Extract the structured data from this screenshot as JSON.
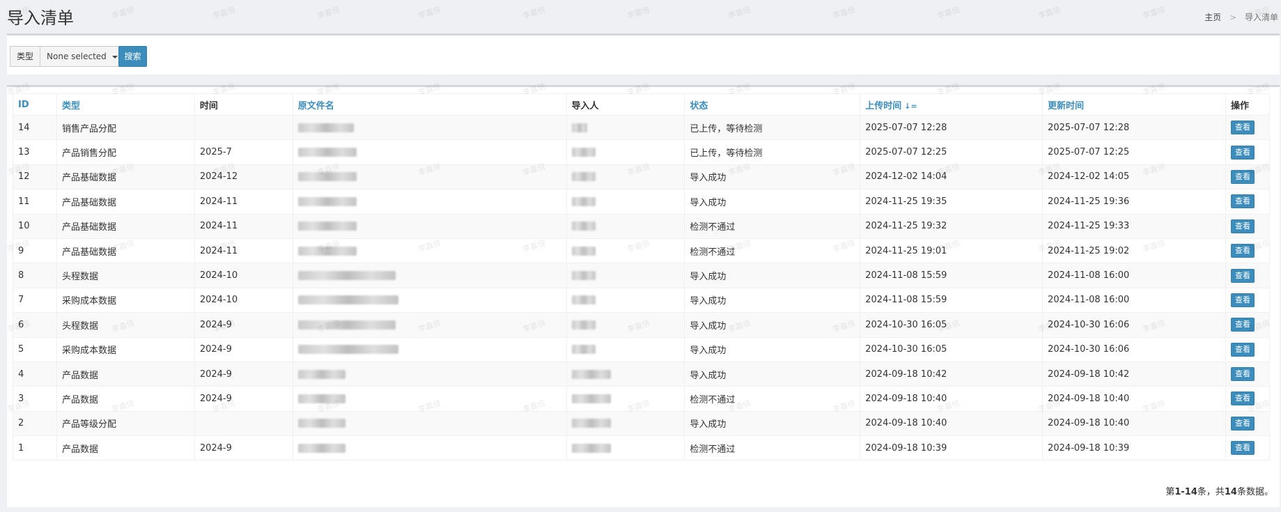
{
  "header": {
    "title": "导入清单",
    "breadcrumb": {
      "home": "主页",
      "sep": ">",
      "current": "导入清单"
    }
  },
  "filter": {
    "type_label": "类型",
    "select_value": "None selected",
    "search_label": "搜索"
  },
  "table": {
    "columns": [
      "ID",
      "类型",
      "时间",
      "原文件名",
      "导入人",
      "状态",
      "上传时间",
      "更新时间",
      "操作"
    ],
    "sort_icon": "↓=",
    "action_label": "查看",
    "rows": [
      {
        "id": "14",
        "type": "销售产品分配",
        "time": "",
        "status": "已上传，等待检测",
        "uploaded": "2025-07-07 12:28",
        "updated": "2025-07-07 12:28"
      },
      {
        "id": "13",
        "type": "产品销售分配",
        "time": "2025-7",
        "status": "已上传，等待检测",
        "uploaded": "2025-07-07 12:25",
        "updated": "2025-07-07 12:25"
      },
      {
        "id": "12",
        "type": "产品基础数据",
        "time": "2024-12",
        "status": "导入成功",
        "uploaded": "2024-12-02 14:04",
        "updated": "2024-12-02 14:05"
      },
      {
        "id": "11",
        "type": "产品基础数据",
        "time": "2024-11",
        "status": "导入成功",
        "uploaded": "2024-11-25 19:35",
        "updated": "2024-11-25 19:36"
      },
      {
        "id": "10",
        "type": "产品基础数据",
        "time": "2024-11",
        "status": "检测不通过",
        "uploaded": "2024-11-25 19:32",
        "updated": "2024-11-25 19:33"
      },
      {
        "id": "9",
        "type": "产品基础数据",
        "time": "2024-11",
        "status": "检测不通过",
        "uploaded": "2024-11-25 19:01",
        "updated": "2024-11-25 19:02"
      },
      {
        "id": "8",
        "type": "头程数据",
        "time": "2024-10",
        "status": "导入成功",
        "uploaded": "2024-11-08 15:59",
        "updated": "2024-11-08 16:00"
      },
      {
        "id": "7",
        "type": "采购成本数据",
        "time": "2024-10",
        "status": "导入成功",
        "uploaded": "2024-11-08 15:59",
        "updated": "2024-11-08 16:00"
      },
      {
        "id": "6",
        "type": "头程数据",
        "time": "2024-9",
        "status": "导入成功",
        "uploaded": "2024-10-30 16:05",
        "updated": "2024-10-30 16:06"
      },
      {
        "id": "5",
        "type": "采购成本数据",
        "time": "2024-9",
        "status": "导入成功",
        "uploaded": "2024-10-30 16:05",
        "updated": "2024-10-30 16:06"
      },
      {
        "id": "4",
        "type": "产品数据",
        "time": "2024-9",
        "status": "导入成功",
        "uploaded": "2024-09-18 10:42",
        "updated": "2024-09-18 10:42"
      },
      {
        "id": "3",
        "type": "产品数据",
        "time": "2024-9",
        "status": "检测不通过",
        "uploaded": "2024-09-18 10:40",
        "updated": "2024-09-18 10:40"
      },
      {
        "id": "2",
        "type": "产品等级分配",
        "time": "",
        "status": "导入成功",
        "uploaded": "2024-09-18 10:40",
        "updated": "2024-09-18 10:40"
      },
      {
        "id": "1",
        "type": "产品数据",
        "time": "2024-9",
        "status": "检测不通过",
        "uploaded": "2024-09-18 10:39",
        "updated": "2024-09-18 10:39"
      }
    ]
  },
  "summary": {
    "prefix": "第",
    "range": "1-14",
    "mid": "条，共",
    "total": "14",
    "suffix": "条数据。"
  },
  "watermark_text": "李嘉倍",
  "colors": {
    "accent": "#3c8dbc",
    "border": "#d2d6de"
  }
}
